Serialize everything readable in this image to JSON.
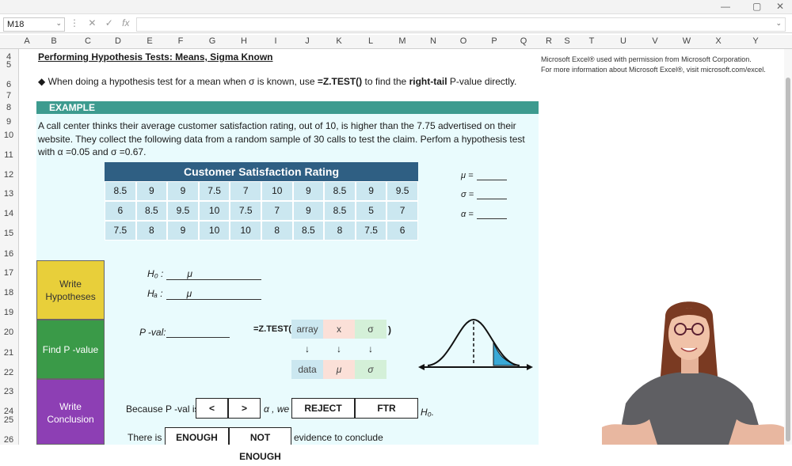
{
  "formula_bar": {
    "name_box": "M18",
    "fx_label": "fx",
    "formula": ""
  },
  "columns": [
    "A",
    "B",
    "C",
    "D",
    "E",
    "F",
    "G",
    "H",
    "I",
    "J",
    "K",
    "L",
    "M",
    "N",
    "O",
    "P",
    "Q",
    "R",
    "S",
    "T",
    "U",
    "V",
    "W",
    "X",
    "Y"
  ],
  "rows": [
    "4",
    "5",
    "6",
    "7",
    "8",
    "9",
    "10",
    "11",
    "12",
    "13",
    "14",
    "15",
    "16",
    "17",
    "18",
    "19",
    "20",
    "21",
    "22",
    "23",
    "24",
    "25",
    "26"
  ],
  "title": "Performing Hypothesis Tests: Means, Sigma Known",
  "credit": {
    "line1": "Microsoft Excel® used with permission from Microsoft Corporation.",
    "line2": "For more information about Microsoft Excel®, visit microsoft.com/excel."
  },
  "bullet": {
    "pre": "When doing a hypothesis test for a mean when σ is known, use ",
    "func": "=Z.TEST()",
    "mid": " to find the ",
    "bold": "right-tail",
    "post": " P-value directly."
  },
  "example_label": "EXAMPLE",
  "problem": "A call center thinks their average customer satisfaction rating, out of 10, is higher than the 7.75 advertised on their website. They collect the following data from a random sample of 30 calls to test the claim. Perfom a hypothesis test with α =0.05 and σ =0.67.",
  "table": {
    "title": "Customer Satisfaction Rating",
    "rows": [
      [
        "8.5",
        "9",
        "9",
        "7.5",
        "7",
        "10",
        "9",
        "8.5",
        "9",
        "9.5"
      ],
      [
        "6",
        "8.5",
        "9.5",
        "10",
        "7.5",
        "7",
        "9",
        "8.5",
        "5",
        "7"
      ],
      [
        "7.5",
        "8",
        "9",
        "10",
        "10",
        "8",
        "8.5",
        "8",
        "7.5",
        "6"
      ]
    ]
  },
  "params": {
    "mu": "μ =",
    "sigma": "σ =",
    "alpha": "α ="
  },
  "steps": {
    "write_hyp": "Write Hypotheses",
    "find_p": "Find P -value",
    "write_conc": "Write Conclusion"
  },
  "hypotheses": {
    "h0_label": "H₀ :",
    "ha_label": "Hₐ :",
    "mu": "μ"
  },
  "pval_label": "P -val:",
  "ztest": {
    "label": "=Z.TEST(",
    "array": "array",
    "x": "x",
    "sigma": "σ",
    "data": "data",
    "mu": "μ",
    "close": ")",
    "arrow": "↓"
  },
  "conclusion": {
    "because": "Because P -val is",
    "lt": "<",
    "gt": ">",
    "alpha_we": "α , we",
    "reject": "REJECT",
    "ftr": "FTR",
    "h0": "H₀.",
    "there_is": "There is",
    "enough": "ENOUGH",
    "not_enough": "NOT ENOUGH",
    "evidence": "evidence to conclude"
  },
  "colors": {
    "example_bar": "#3d9b8f",
    "table_header": "#2f5f83",
    "cell": "#cbe7f0",
    "yellow": "#e8cf3a",
    "green": "#3a9a48",
    "purple": "#8d3fb4",
    "pink": "#fbe0d8",
    "mint": "#d4f0d8"
  }
}
